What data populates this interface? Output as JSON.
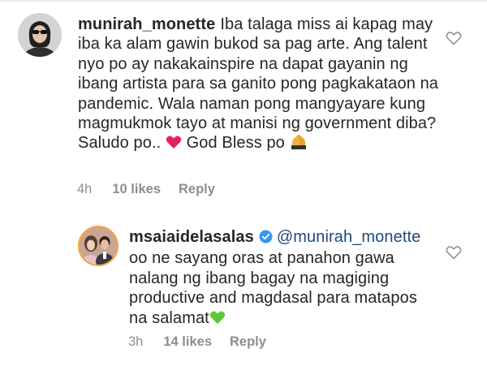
{
  "comments": [
    {
      "username": "munirah_monette",
      "text_line_1": "Iba talaga miss ai kapag",
      "text_rest": "may iba ka alam gawin bukod sa pag arte. Ang talent nyo po ay nakakainspire na dapat gayanin ng ibang artista para sa ganito pong pagkakataon na pandemic. Wala naman pong mangyayare kung magmukmok tayo at manisi ng government diba? Saludo po..",
      "text_after_heart": " God Bless po",
      "timestamp": "4h",
      "likes": "10 likes",
      "reply_label": "Reply"
    },
    {
      "username": "msaiaidelasalas",
      "mention": "@munirah_monette",
      "text": "oo ne sayang oras at panahon gawa nalang ng ibang bagay na magiging productive and magdasal para matapos na salamat",
      "timestamp": "3h",
      "likes": "14 likes",
      "reply_label": "Reply"
    }
  ],
  "icons": {
    "like": "heart-outline-icon",
    "red_heart_emoji": "red-heart-icon",
    "green_heart_emoji": "green-heart-icon",
    "prayer_emoji": "folded-hands-icon",
    "verified": "verified-badge-icon"
  },
  "colors": {
    "text": "#262626",
    "meta": "#8e8e8e",
    "mention": "#21497a",
    "verified": "#3897f0",
    "red_heart": "#e0245e",
    "green_heart": "#5cc93b"
  }
}
